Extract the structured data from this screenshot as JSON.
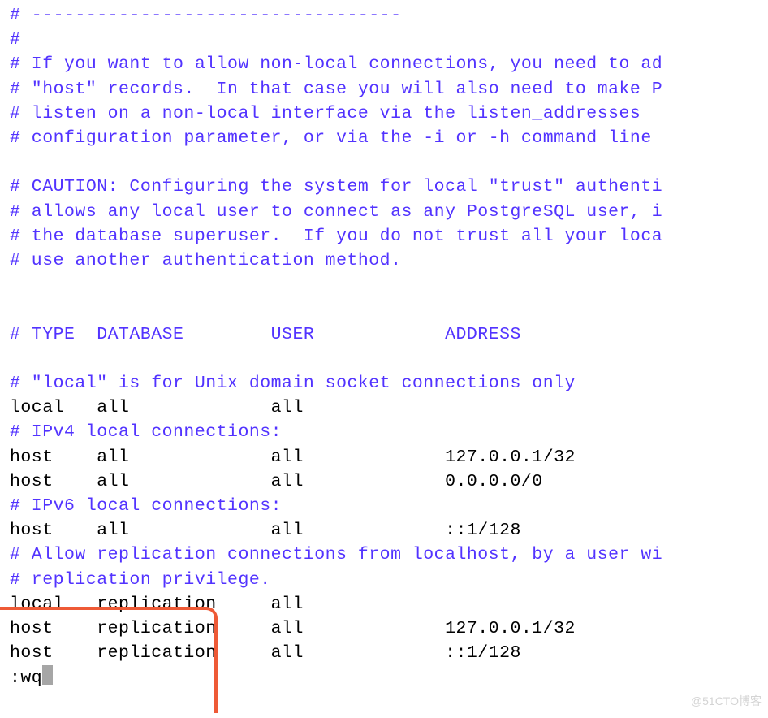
{
  "colors": {
    "comment": "#5233ff",
    "normal": "#000000",
    "highlight_border": "#ee5a36",
    "cursor": "#a6a6a6"
  },
  "watermark": "@51CTO博客",
  "vim_command": ":wq",
  "lines": [
    {
      "kind": "comment",
      "text": "# ----------------------------------"
    },
    {
      "kind": "comment",
      "text": "#"
    },
    {
      "kind": "comment",
      "text": "# If you want to allow non-local connections, you need to ad"
    },
    {
      "kind": "comment",
      "text": "# \"host\" records.  In that case you will also need to make P"
    },
    {
      "kind": "comment",
      "text": "# listen on a non-local interface via the listen_addresses"
    },
    {
      "kind": "comment",
      "text": "# configuration parameter, or via the -i or -h command line "
    },
    {
      "kind": "blank",
      "text": ""
    },
    {
      "kind": "comment",
      "text": "# CAUTION: Configuring the system for local \"trust\" authenti"
    },
    {
      "kind": "comment",
      "text": "# allows any local user to connect as any PostgreSQL user, i"
    },
    {
      "kind": "comment",
      "text": "# the database superuser.  If you do not trust all your loca"
    },
    {
      "kind": "comment",
      "text": "# use another authentication method."
    },
    {
      "kind": "blank",
      "text": ""
    },
    {
      "kind": "blank",
      "text": ""
    },
    {
      "kind": "comment",
      "text": "# TYPE  DATABASE        USER            ADDRESS"
    },
    {
      "kind": "blank",
      "text": ""
    },
    {
      "kind": "comment",
      "text": "# \"local\" is for Unix domain socket connections only"
    },
    {
      "kind": "normal",
      "text": "local   all             all"
    },
    {
      "kind": "comment",
      "text": "# IPv4 local connections:"
    },
    {
      "kind": "normal",
      "text": "host    all             all             127.0.0.1/32"
    },
    {
      "kind": "normal",
      "text": "host    all             all             0.0.0.0/0"
    },
    {
      "kind": "comment",
      "text": "# IPv6 local connections:"
    },
    {
      "kind": "normal",
      "text": "host    all             all             ::1/128"
    },
    {
      "kind": "comment",
      "text": "# Allow replication connections from localhost, by a user wi"
    },
    {
      "kind": "comment",
      "text": "# replication privilege."
    },
    {
      "kind": "normal",
      "text": "local   replication     all"
    },
    {
      "kind": "normal",
      "text": "host    replication     all             127.0.0.1/32"
    },
    {
      "kind": "normal",
      "text": "host    replication     all             ::1/128"
    }
  ]
}
